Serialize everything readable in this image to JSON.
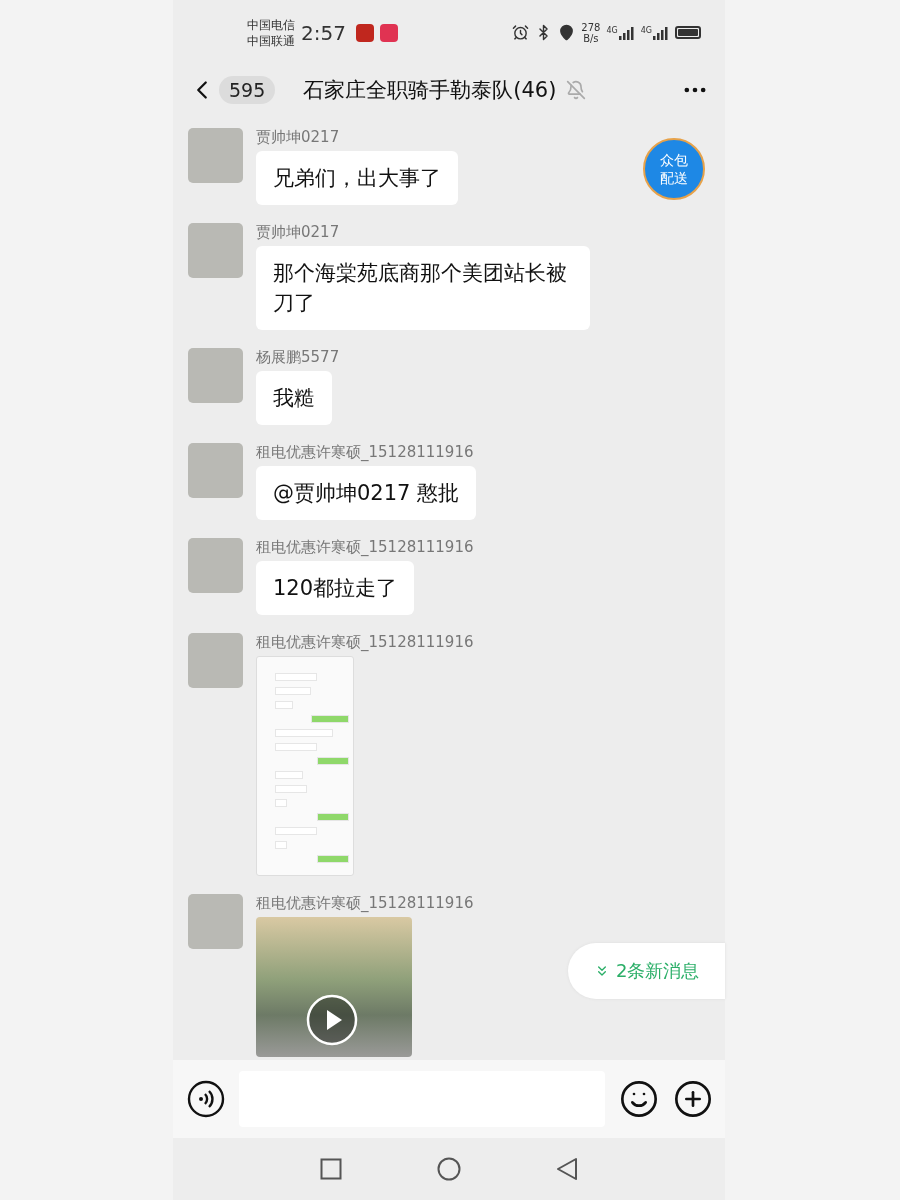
{
  "status_bar": {
    "carriers": [
      "中国电信",
      "中国联通"
    ],
    "time": "2:57",
    "speed": [
      "278",
      "B/s"
    ],
    "networks": [
      "4G",
      "4G"
    ]
  },
  "header": {
    "unread_count": "595",
    "title": "石家庄全职骑手勒泰队(46)",
    "muted": true
  },
  "floating_badge": {
    "lines": [
      "众包",
      "配送"
    ]
  },
  "messages": [
    {
      "sender": "贾帅坤0217",
      "kind": "text",
      "text": "兄弟们，出大事了"
    },
    {
      "sender": "贾帅坤0217",
      "kind": "text",
      "text": "那个海棠苑底商那个美团站长被刀了"
    },
    {
      "sender": "杨展鹏5577",
      "kind": "text",
      "text": "我糙"
    },
    {
      "sender": "租电优惠许寒硕_15128111916",
      "kind": "text",
      "text": "@贾帅坤0217 憨批"
    },
    {
      "sender": "租电优惠许寒硕_15128111916",
      "kind": "text",
      "text": "120都拉走了"
    },
    {
      "sender": "租电优惠许寒硕_15128111916",
      "kind": "screenshot"
    },
    {
      "sender": "租电优惠许寒硕_15128111916",
      "kind": "video"
    }
  ],
  "new_messages": {
    "label": "2条新消息"
  }
}
